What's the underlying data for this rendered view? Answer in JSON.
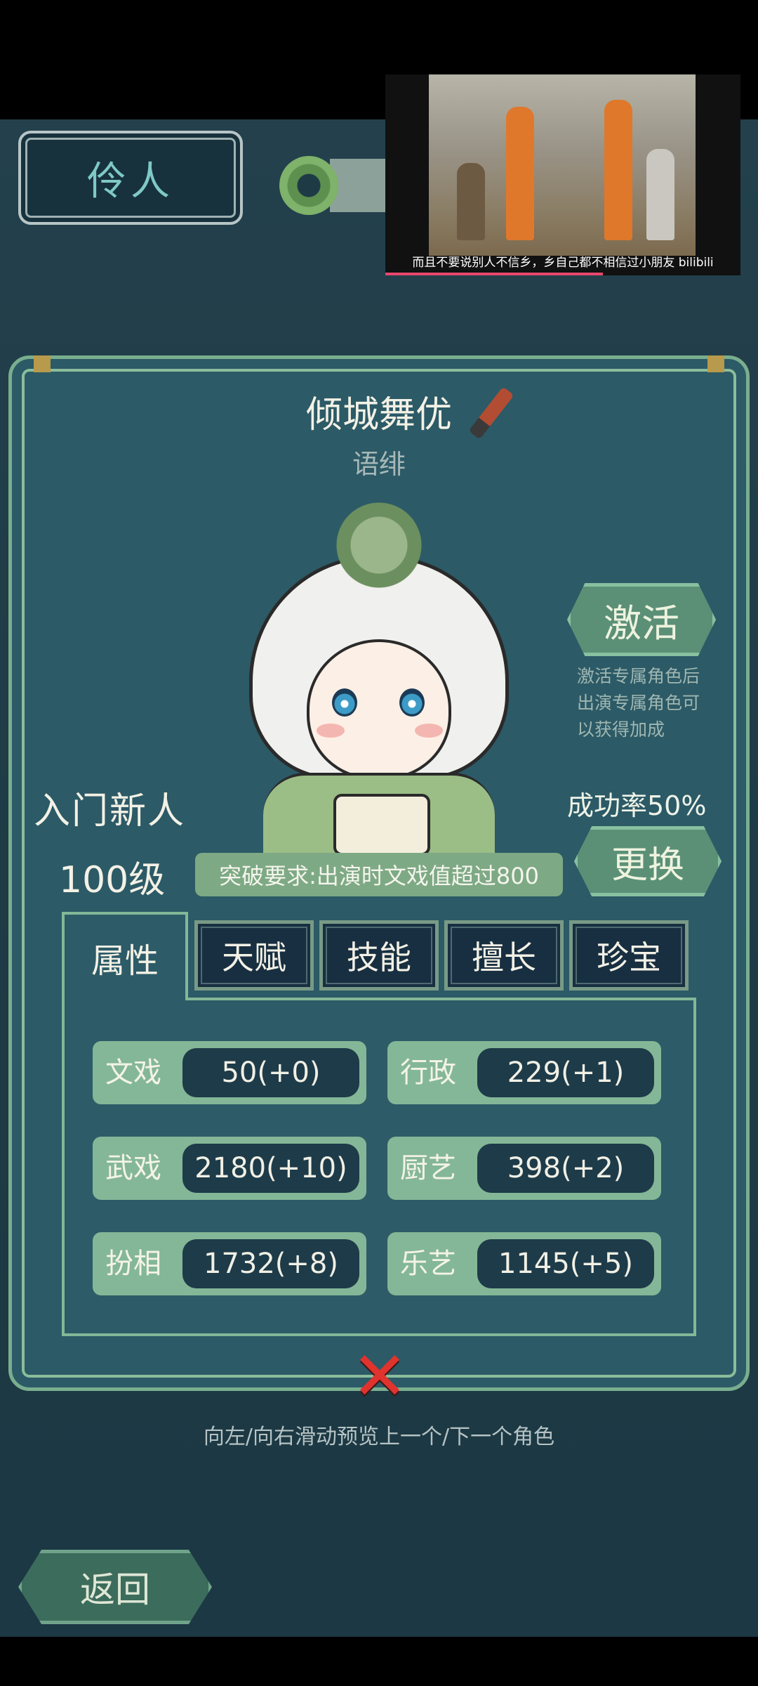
{
  "header": {
    "title": "伶人"
  },
  "video_overlay": {
    "subtitle": "而且不要说别人不信乡，乡自己都不相信过小朋友 bilibili"
  },
  "character": {
    "title": "倾城舞优",
    "name": "语绯",
    "rank": "入门新人",
    "level": "100级",
    "success_rate": "成功率50%",
    "break_requirement": "突破要求:出演时文戏值超过800"
  },
  "activate": {
    "label": "激活",
    "note_lines": [
      "激活专属角色后",
      "出演专属角色可",
      "以获得加成"
    ]
  },
  "change": {
    "label": "更换"
  },
  "tabs": [
    {
      "label": "属性",
      "active": true
    },
    {
      "label": "天赋",
      "active": false
    },
    {
      "label": "技能",
      "active": false
    },
    {
      "label": "擅长",
      "active": false
    },
    {
      "label": "珍宝",
      "active": false
    }
  ],
  "stats": [
    {
      "label": "文戏",
      "value": "50(+0)"
    },
    {
      "label": "行政",
      "value": "229(+1)"
    },
    {
      "label": "武戏",
      "value": "2180(+10)"
    },
    {
      "label": "厨艺",
      "value": "398(+2)"
    },
    {
      "label": "扮相",
      "value": "1732(+8)"
    },
    {
      "label": "乐艺",
      "value": "1145(+5)"
    }
  ],
  "hint": "向左/向右滑动预览上一个/下一个角色",
  "back": {
    "label": "返回"
  },
  "close": {
    "symbol": "✕"
  },
  "colors": {
    "accent_green": "#84b797",
    "panel": "#2c5a66",
    "close_red": "#e0332e"
  }
}
